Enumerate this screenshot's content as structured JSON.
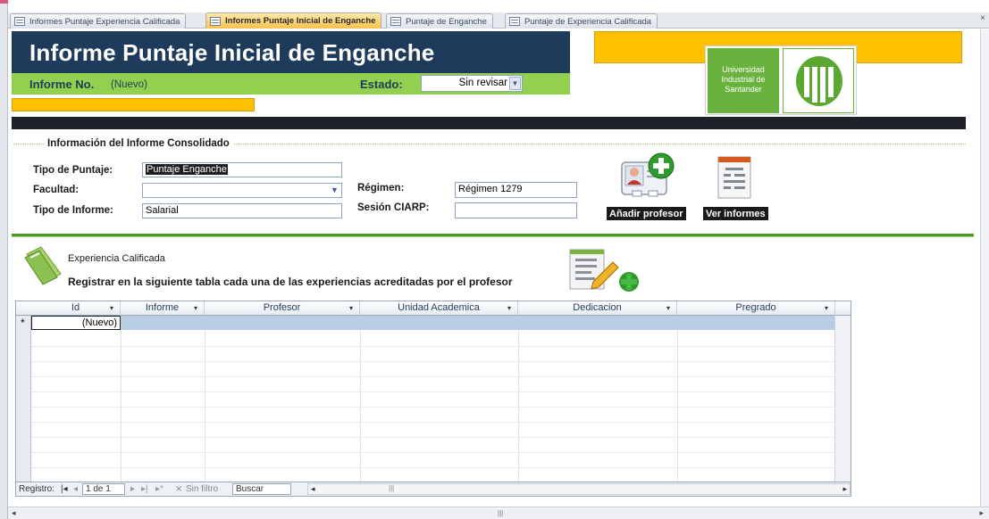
{
  "tabs": [
    {
      "label": "Informes Puntaje Experiencia Calificada",
      "active": false
    },
    {
      "label": "Informes Puntaje Inicial de Enganche",
      "active": true
    },
    {
      "label": "Puntaje de Enganche",
      "active": false
    },
    {
      "label": "Puntaje de Experiencia Calificada",
      "active": false
    }
  ],
  "header": {
    "title": "Informe Puntaje Inicial de Enganche",
    "informe_no_label": "Informe No.",
    "informe_no_value": "(Nuevo)",
    "estado_label": "Estado:",
    "estado_value": "Sin revisar"
  },
  "logo": {
    "line1": "Universidad",
    "line2": "Industrial de",
    "line3": "Santander"
  },
  "section1": {
    "title": "Información del Informe Consolidado",
    "tipo_puntaje_label": "Tipo de Puntaje:",
    "tipo_puntaje_value": "Puntaje Enganche",
    "facultad_label": "Facultad:",
    "facultad_value": "",
    "tipo_informe_label": "Tipo de Informe:",
    "tipo_informe_value": "Salarial",
    "regimen_label": "Régimen:",
    "regimen_value": "Régimen 1279",
    "sesion_label": "Sesión CIARP:",
    "sesion_value": "",
    "add_professor_label": "Añadir profesor",
    "view_reports_label": "Ver informes"
  },
  "section2": {
    "title": "Experiencia Calificada",
    "subtitle": "Registrar en la siguiente tabla cada una de las experiencias acreditadas por el profesor"
  },
  "table": {
    "columns": [
      "Id",
      "Informe",
      "Profesor",
      "Unidad Academica",
      "Dedicacion",
      "Pregrado"
    ],
    "new_row_marker": "*",
    "new_row_id": "(Nuevo)"
  },
  "record_nav": {
    "label": "Registro:",
    "position": "1 de 1",
    "filter_label": "Sin filtro",
    "search_label": "Buscar"
  },
  "colors": {
    "header_blue": "#1f3b5b",
    "green_bar": "#92d050",
    "accent_yellow": "#ffc000",
    "dark_bar": "#1e2127",
    "selected_row": "#b8cce4"
  }
}
